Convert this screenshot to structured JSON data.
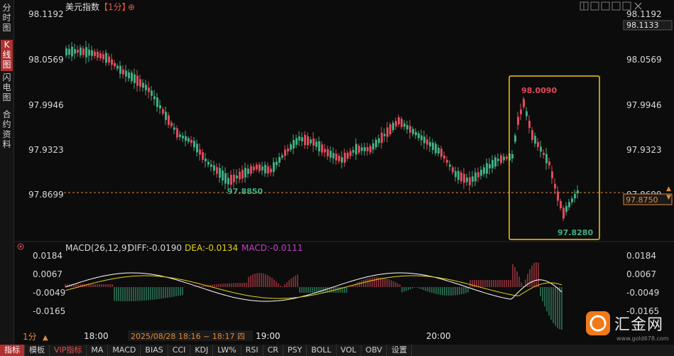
{
  "left_tabs": [
    {
      "label": "分时图",
      "active": false
    },
    {
      "label": "K线图",
      "active": true
    },
    {
      "label": "闪电图",
      "active": false
    },
    {
      "label": "合约资料",
      "active": false
    }
  ],
  "header": {
    "title": "美元指数",
    "period_badge": "【1分】",
    "add_symbol": "⊕"
  },
  "toolbar_icons": [
    "crosshair-icon",
    "expand-icon",
    "chart-type-icon",
    "restore-icon",
    "maximize-icon",
    "close-icon"
  ],
  "price_axis": {
    "ticks": [
      "98.1192",
      "98.0569",
      "97.9946",
      "97.9323",
      "97.8699"
    ],
    "current_price": "98.1133",
    "last_price": "97.8750"
  },
  "annotations": {
    "low_left": "97.8850",
    "high": "98.0090",
    "low_right": "97.8280"
  },
  "macd": {
    "name": "MACD(26,12,9)",
    "diff": "DIFF:-0.0190",
    "dea": "DEA:-0.0134",
    "macd": "MACD:-0.0111",
    "ticks": [
      "0.0184",
      "0.0067",
      "-0.0049",
      "-0.0165"
    ]
  },
  "time_axis": {
    "period": "1分",
    "labels": [
      "18:00",
      "19:00",
      "20:00"
    ],
    "cursor_time": "2025/08/28 18:16 ~ 18:17 四"
  },
  "bottom_tabs": [
    {
      "label": "指标",
      "active": true,
      "vip": false
    },
    {
      "label": "模板",
      "active": false,
      "vip": false
    },
    {
      "label": "VIP指标",
      "active": false,
      "vip": true
    },
    {
      "label": "MA",
      "active": false,
      "vip": false
    },
    {
      "label": "MACD",
      "active": false,
      "vip": false
    },
    {
      "label": "BIAS",
      "active": false,
      "vip": false
    },
    {
      "label": "CCI",
      "active": false,
      "vip": false
    },
    {
      "label": "KDJ",
      "active": false,
      "vip": false
    },
    {
      "label": "LW%",
      "active": false,
      "vip": false
    },
    {
      "label": "RSI",
      "active": false,
      "vip": false
    },
    {
      "label": "CR",
      "active": false,
      "vip": false
    },
    {
      "label": "PSY",
      "active": false,
      "vip": false
    },
    {
      "label": "BOLL",
      "active": false,
      "vip": false
    },
    {
      "label": "VOL",
      "active": false,
      "vip": false
    },
    {
      "label": "OBV",
      "active": false,
      "vip": false
    },
    {
      "label": "设置",
      "active": false,
      "vip": false
    }
  ],
  "logo": {
    "text": "汇金网",
    "site": "www.gold678.com"
  },
  "colors": {
    "up": "#e04a5a",
    "down": "#3fae82",
    "diff_line": "#ffffff",
    "dea_line": "#e6d21a",
    "highlight_box": "#f5c518",
    "ref_line": "#e08a3a"
  }
}
